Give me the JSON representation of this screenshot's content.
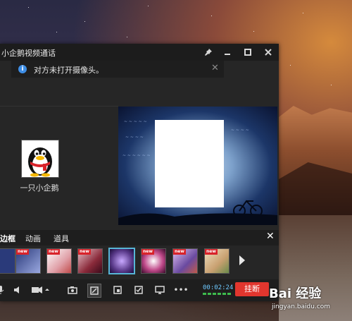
{
  "window": {
    "title": "小企鹅视频通话",
    "buttons": {
      "pin": "pin-icon",
      "minimize": "minimize-icon",
      "maximize": "maximize-icon",
      "close": "close-icon"
    }
  },
  "notice": {
    "text": "对方未打开摄像头。",
    "icon": "info-icon"
  },
  "contact": {
    "name": "一只小企鹅",
    "avatar": "qq-penguin-avatar"
  },
  "effects": {
    "tabs": [
      "边框",
      "动画",
      "道具"
    ],
    "active_tab": "边框",
    "thumbnails": [
      {
        "new": false,
        "selected": false,
        "color": "#2a3a7a"
      },
      {
        "new": true,
        "selected": false,
        "color": "#4a5aa8"
      },
      {
        "new": true,
        "selected": false,
        "color": "#e0a0a8"
      },
      {
        "new": true,
        "selected": false,
        "color": "#8a2a3a"
      },
      {
        "new": false,
        "selected": true,
        "color": "#5a3a8a"
      },
      {
        "new": true,
        "selected": false,
        "color": "#c04a8a"
      },
      {
        "new": true,
        "selected": false,
        "color": "#6a4aa0"
      },
      {
        "new": true,
        "selected": false,
        "color": "#c8a070"
      }
    ],
    "new_label": "new"
  },
  "toolbar": {
    "icons": [
      "microphone-icon",
      "speaker-icon",
      "camera-icon",
      "snapshot-icon",
      "effects-icon",
      "picture-in-picture-icon",
      "whiteboard-icon",
      "screen-share-icon",
      "more-icon"
    ],
    "timer": "00:02:24",
    "hangup_label": "挂断"
  },
  "watermark": {
    "logo": "Bai 经验",
    "url": "jingyan.baidu.com"
  },
  "colors": {
    "accent_blue": "#57b6d6",
    "hangup_red": "#e1362e",
    "info_blue": "#3e8ee6",
    "timer_blue": "#6ec9ff",
    "level_green": "#3dbb4d"
  }
}
